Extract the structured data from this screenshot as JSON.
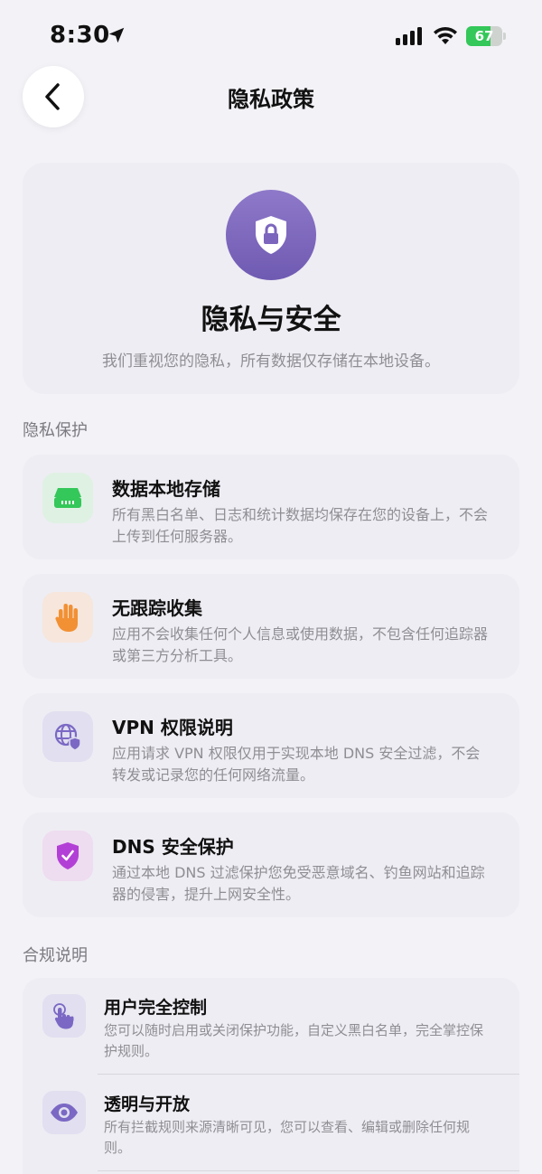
{
  "status": {
    "time": "8:30",
    "battery": "67",
    "battery_level": 0.67
  },
  "nav": {
    "title": "隐私政策"
  },
  "hero": {
    "title": "隐私与安全",
    "subtitle": "我们重视您的隐私，所有数据仅存储在本地设备。"
  },
  "sections": {
    "privacy": "隐私保护",
    "compliance": "合规说明"
  },
  "features": [
    {
      "title": "数据本地存储",
      "desc": "所有黑白名单、日志和统计数据均保存在您的设备上，不会上传到任何服务器。",
      "icon": "storage-icon",
      "bg": "#dff1e3",
      "color": "#34c759"
    },
    {
      "title": "无跟踪收集",
      "desc": "应用不会收集任何个人信息或使用数据，不包含任何追踪器或第三方分析工具。",
      "icon": "hand-stop-icon",
      "bg": "#f6e6dc",
      "color": "#f29034"
    },
    {
      "title": "VPN 权限说明",
      "desc": "应用请求 VPN 权限仅用于实现本地 DNS 安全过滤，不会转发或记录您的任何网络流量。",
      "icon": "globe-lock-icon",
      "bg": "#e1dff0",
      "color": "#7b68c4"
    },
    {
      "title": "DNS 安全保护",
      "desc": "通过本地 DNS 过滤保护您免受恶意域名、钓鱼网站和追踪器的侵害，提升上网安全性。",
      "icon": "shield-check-icon",
      "bg": "#eedcf0",
      "color": "#b340d6"
    }
  ],
  "compliance": [
    {
      "title": "用户完全控制",
      "desc": "您可以随时启用或关闭保护功能，自定义黑白名单，完全掌控保护规则。",
      "icon": "hand-tap-icon"
    },
    {
      "title": "透明与开放",
      "desc": "所有拦截规则来源清晰可见，您可以查看、编辑或删除任何规则。",
      "icon": "eye-icon"
    }
  ]
}
